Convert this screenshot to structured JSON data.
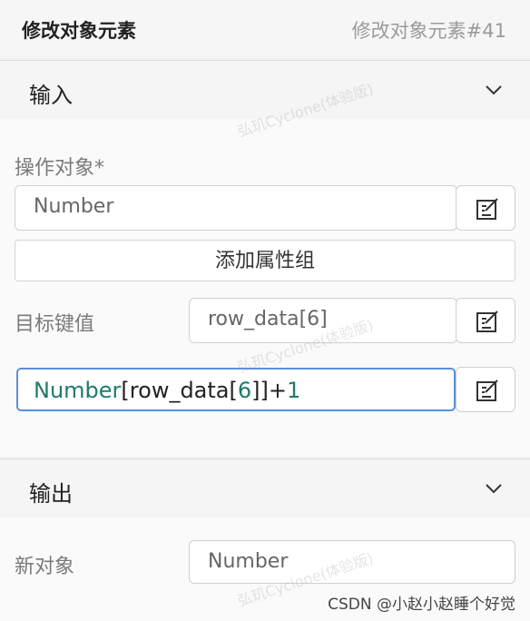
{
  "header": {
    "title": "修改对象元素",
    "subtitle": "修改对象元素#41"
  },
  "input_section": {
    "title": "输入",
    "operation_target": {
      "label": "操作对象*",
      "value": "Number"
    },
    "add_group_label": "添加属性组",
    "target_key": {
      "label": "目标键值",
      "value": "row_data[6]"
    },
    "expression": {
      "tokens": [
        {
          "text": "Number",
          "kind": "ident"
        },
        {
          "text": "[",
          "kind": "plain"
        },
        {
          "text": "row_data",
          "kind": "plain"
        },
        {
          "text": "[",
          "kind": "plain"
        },
        {
          "text": "6",
          "kind": "ident"
        },
        {
          "text": "]]",
          "kind": "plain"
        },
        {
          "text": "+",
          "kind": "plain"
        },
        {
          "text": "1",
          "kind": "ident"
        }
      ]
    }
  },
  "output_section": {
    "title": "输出",
    "new_object": {
      "label": "新对象",
      "value": "Number"
    }
  },
  "watermark": "弘玑Cyclone(体验版)",
  "credit": "CSDN @小赵小赵睡个好觉",
  "colors": {
    "ident": "#1e7a6c",
    "focus_border": "#5b8fe0"
  }
}
